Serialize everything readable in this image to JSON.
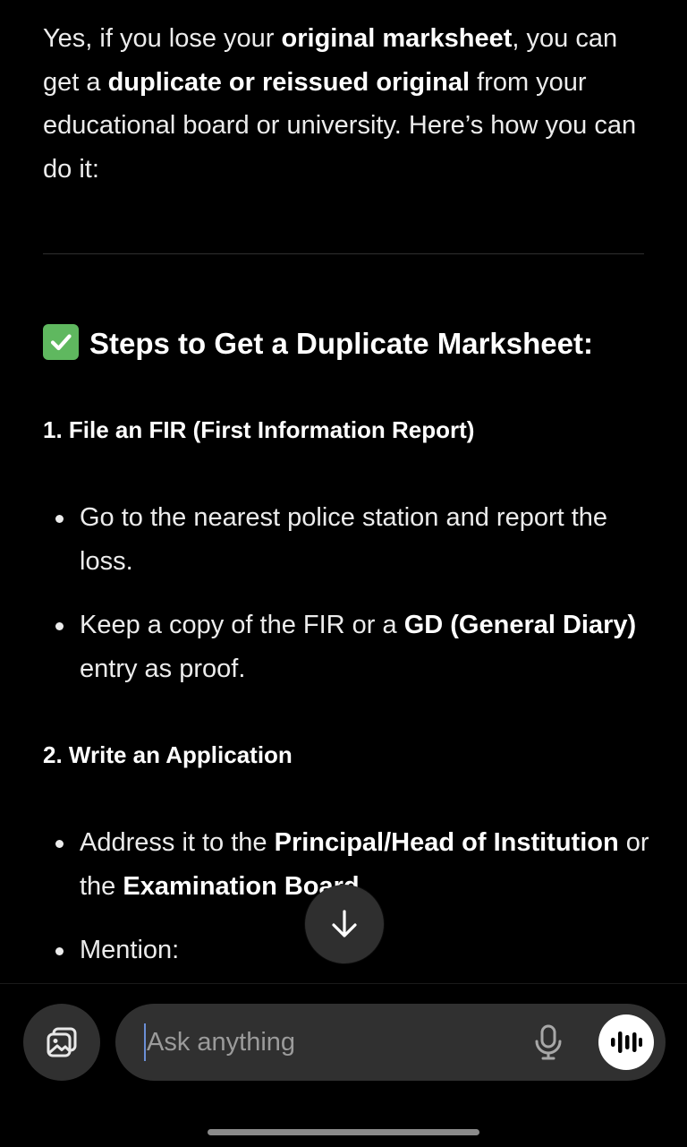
{
  "intro": {
    "t1": "Yes, if you lose your ",
    "b1": "original marksheet",
    "t2": ", you can get a ",
    "b2": "duplicate or reissued original",
    "t3": " from your educational board or university. Here’s how you can do it:"
  },
  "section": {
    "check_icon": "white-check-mark",
    "heading": "Steps to Get a Duplicate Marksheet:"
  },
  "steps": [
    {
      "title": "1. File an FIR (First Information Report)",
      "bullets": [
        {
          "t1": "Go to the nearest police station and report the loss."
        },
        {
          "t1": "Keep a copy of the FIR or a ",
          "b1": "GD (General Diary)",
          "t2": " entry as proof."
        }
      ]
    },
    {
      "title": "2. Write an Application",
      "bullets": [
        {
          "t1": "Address it to the ",
          "b1": "Principal/Head of Institution",
          "t2": " or the ",
          "b2": "Examination Board",
          "t3": "."
        },
        {
          "t1": "Mention:"
        }
      ]
    }
  ],
  "composer": {
    "placeholder": "Ask anything",
    "attach_icon": "image-attach-icon",
    "mic_icon": "microphone-icon",
    "voice_icon": "voice-waveform-icon"
  },
  "scroll_icon": "arrow-down-icon"
}
